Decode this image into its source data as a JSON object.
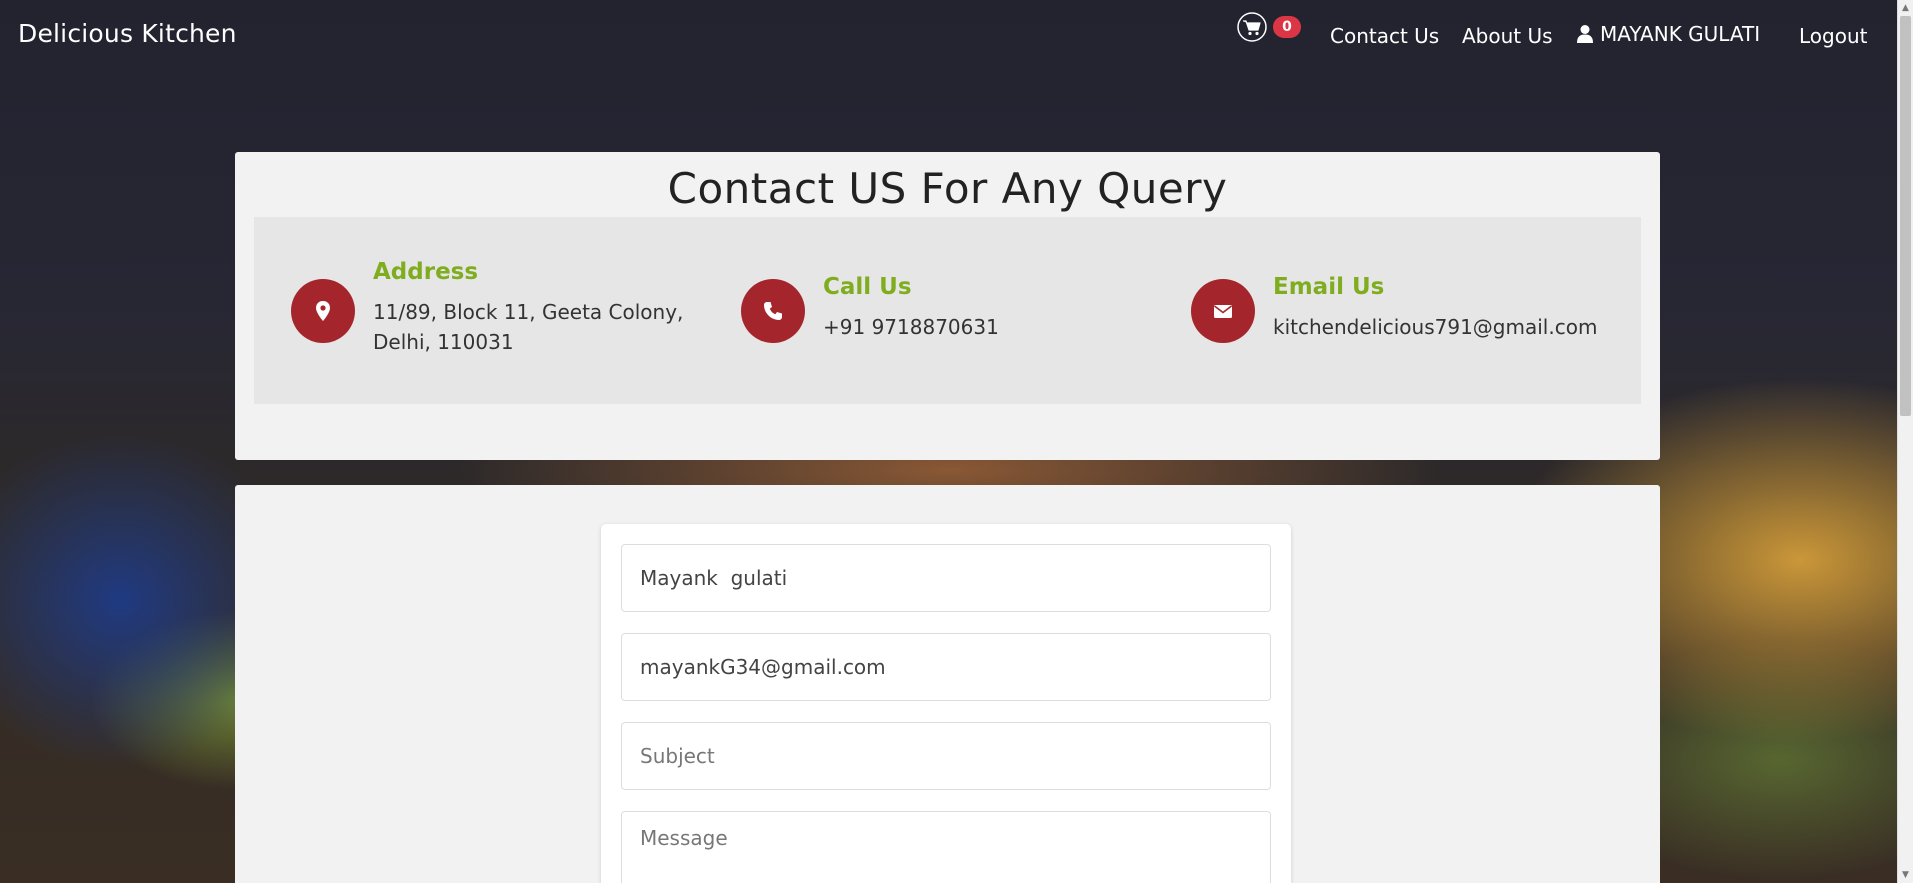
{
  "nav": {
    "brand": "Delicious Kitchen",
    "cart_count": "0",
    "contact_label": "Contact Us",
    "about_label": "About Us",
    "user_name": "MAYANK GULATI",
    "logout_label": "Logout"
  },
  "contact": {
    "title": "Contact US For Any Query",
    "address": {
      "heading": "Address",
      "line1": "11/89, Block 11, Geeta Colony,",
      "line2": "Delhi, 110031"
    },
    "call": {
      "heading": "Call Us",
      "text": "+91 9718870631"
    },
    "email": {
      "heading": "Email Us",
      "text": "kitchendelicious791@gmail.com"
    }
  },
  "form": {
    "name_value": "Mayank  gulati",
    "email_value": "mayankG34@gmail.com",
    "subject_placeholder": "Subject",
    "message_placeholder": "Message"
  },
  "icons": {
    "cart": "shopping-cart-icon",
    "user": "user-icon",
    "address": "map-marker-icon",
    "call": "phone-icon",
    "email": "envelope-icon"
  },
  "colors": {
    "accent_red": "#a4262c",
    "heading_green": "#7fad1f",
    "badge_red": "#dc3545"
  }
}
